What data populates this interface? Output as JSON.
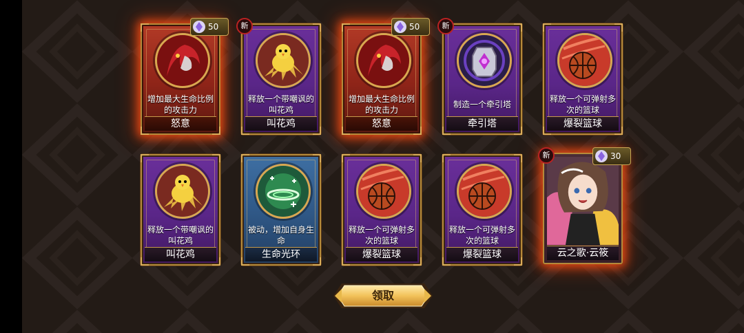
{
  "colors": {
    "background": "#1f1814",
    "purple_card": "#5a2688",
    "red_card": "#8e2418",
    "blue_card": "#2f5785",
    "gold_border": "#b58a3a",
    "glow": "#ff5014"
  },
  "cards": [
    {
      "name": "怒意",
      "description": "增加最大生命比例的攻击力",
      "rarity": "red",
      "icon": "rage-demon-icon",
      "price": "50",
      "is_new": false
    },
    {
      "name": "叫花鸡",
      "description": "释放一个带嘲讽的叫花鸡",
      "rarity": "purple",
      "icon": "taunt-chick-icon",
      "price": null,
      "is_new": true,
      "new_label": "新"
    },
    {
      "name": "怒意",
      "description": "增加最大生命比例的攻击力",
      "rarity": "red",
      "icon": "rage-demon-icon",
      "price": "50",
      "is_new": false
    },
    {
      "name": "牵引塔",
      "description": "制造一个牵引塔",
      "rarity": "purple",
      "icon": "traction-tower-icon",
      "price": null,
      "is_new": true,
      "new_label": "新"
    },
    {
      "name": "爆裂篮球",
      "description": "释放一个可弹射多次的篮球",
      "rarity": "purple",
      "icon": "basketball-icon",
      "price": null,
      "is_new": false
    },
    {
      "name": "叫花鸡",
      "description": "释放一个带嘲讽的叫花鸡",
      "rarity": "purple",
      "icon": "taunt-chick-icon",
      "price": null,
      "is_new": false
    },
    {
      "name": "生命光环",
      "description": "被动，增加自身生命",
      "rarity": "blue",
      "icon": "life-aura-icon",
      "price": null,
      "is_new": false
    },
    {
      "name": "爆裂篮球",
      "description": "释放一个可弹射多次的篮球",
      "rarity": "purple",
      "icon": "basketball-icon",
      "price": null,
      "is_new": false
    },
    {
      "name": "爆裂篮球",
      "description": "释放一个可弹射多次的篮球",
      "rarity": "purple",
      "icon": "basketball-icon",
      "price": null,
      "is_new": false
    },
    {
      "name": "云之歌·云筱",
      "description": "",
      "rarity": "hero",
      "icon": "hero-portrait-icon",
      "price": "30",
      "is_new": true,
      "new_label": "新"
    }
  ],
  "claim_button": {
    "label": "领取"
  }
}
